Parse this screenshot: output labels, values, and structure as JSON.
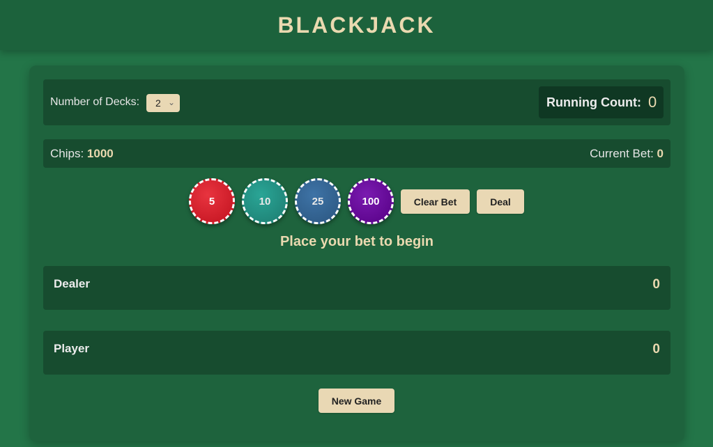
{
  "header": {
    "title": "BLACKJACK"
  },
  "settings": {
    "decks_label": "Number of Decks:",
    "decks_value": "2",
    "running_count_label": "Running Count:",
    "running_count_value": "0"
  },
  "bank": {
    "chips_label": "Chips:",
    "chips_value": "1000",
    "bet_label": "Current Bet:",
    "bet_value": "0"
  },
  "chips": [
    {
      "label": "5",
      "color": "#d41a28"
    },
    {
      "label": "10",
      "color": "#24907f"
    },
    {
      "label": "25",
      "color": "#356494"
    },
    {
      "label": "100",
      "color": "#67099a"
    }
  ],
  "buttons": {
    "clear_bet": "Clear Bet",
    "deal": "Deal",
    "new_game": "New Game"
  },
  "status": "Place your bet to begin",
  "dealer": {
    "label": "Dealer",
    "score": "0"
  },
  "player": {
    "label": "Player",
    "score": "0"
  },
  "colors": {
    "background": "#237548",
    "panel": "#1e633d",
    "bar": "#174c2f",
    "accent": "#ead9b0"
  }
}
